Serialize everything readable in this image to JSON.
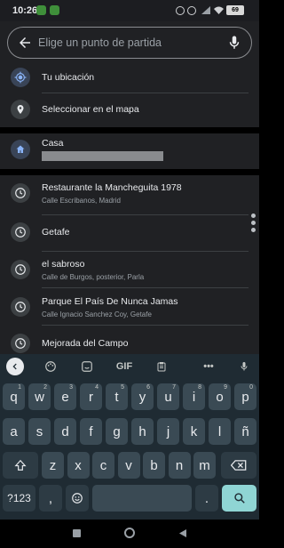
{
  "status_bar": {
    "time": "10:26",
    "battery": "69"
  },
  "search": {
    "placeholder": "Elige un punto de partida"
  },
  "quick_options": [
    {
      "label": "Tu ubicación",
      "icon": "my-location-icon"
    },
    {
      "label": "Seleccionar en el mapa",
      "icon": "map-pin-icon"
    }
  ],
  "saved_place": {
    "label": "Casa",
    "icon": "home-icon"
  },
  "history": [
    {
      "title": "Restaurante la Mancheguita 1978",
      "subtitle": "Calle Escribanos, Madrid",
      "icon": "clock-icon"
    },
    {
      "title": "Getafe",
      "subtitle": "",
      "icon": "clock-icon"
    },
    {
      "title": "el sabroso",
      "subtitle": "Calle de Burgos, posterior, Parla",
      "icon": "clock-icon"
    },
    {
      "title": "Parque El País De Nunca Jamas",
      "subtitle": "Calle Ignacio Sanchez Coy, Getafe",
      "icon": "clock-icon"
    },
    {
      "title": "Mejorada del Campo",
      "subtitle": "",
      "icon": "clock-icon"
    }
  ],
  "keyboard": {
    "toolbar": {
      "gif_label": "GIF",
      "more_label": "•••"
    },
    "row1": [
      {
        "k": "q",
        "n": "1"
      },
      {
        "k": "w",
        "n": "2"
      },
      {
        "k": "e",
        "n": "3"
      },
      {
        "k": "r",
        "n": "4"
      },
      {
        "k": "t",
        "n": "5"
      },
      {
        "k": "y",
        "n": "6"
      },
      {
        "k": "u",
        "n": "7"
      },
      {
        "k": "i",
        "n": "8"
      },
      {
        "k": "o",
        "n": "9"
      },
      {
        "k": "p",
        "n": "0"
      }
    ],
    "row2": [
      "a",
      "s",
      "d",
      "f",
      "g",
      "h",
      "j",
      "k",
      "l",
      "ñ"
    ],
    "row3": [
      "z",
      "x",
      "c",
      "v",
      "b",
      "n",
      "m"
    ],
    "symbols_label": "?123",
    "comma_label": ",",
    "period_label": "."
  },
  "colors": {
    "accent": "#8ab4f8",
    "keyboard_bg": "#1f2b33",
    "key_bg": "#3a4a54",
    "search_key": "#8fd5d4"
  }
}
